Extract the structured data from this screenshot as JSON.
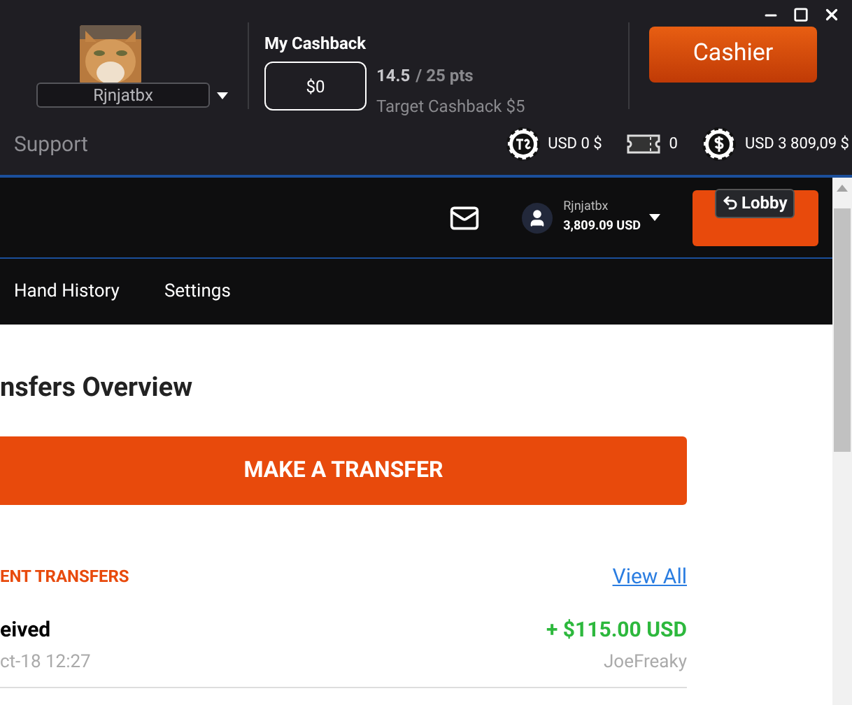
{
  "profile": {
    "username": "Rjnjatbx"
  },
  "cashback": {
    "title": "My Cashback",
    "amount": "$0",
    "points": "14.5",
    "points_total": "/ 25 pts",
    "target": "Target Cashback $5"
  },
  "cashier_button": "Cashier",
  "support_link": "Support",
  "balances": [
    {
      "kind": "tchip",
      "value": "USD 0 $"
    },
    {
      "kind": "ticket",
      "value": "0"
    },
    {
      "kind": "chip",
      "value": "USD 3 809,09 $"
    }
  ],
  "account_bar": {
    "username": "Rjnjatbx",
    "balance": "3,809.09 USD",
    "lobby_button": "Lobby"
  },
  "tabs": [
    {
      "label": "Hand History",
      "selected": false
    },
    {
      "label": "Settings",
      "selected": false
    }
  ],
  "page_title": "nsfers Overview",
  "transfer_button": "MAKE A TRANSFER",
  "recent": {
    "heading": "ENT TRANSFERS",
    "view_all": "View All"
  },
  "transfers": [
    {
      "type": "eived",
      "date": "ct-18 12:27",
      "amount": "+ $115.00 USD",
      "user": "JoeFreaky"
    }
  ]
}
